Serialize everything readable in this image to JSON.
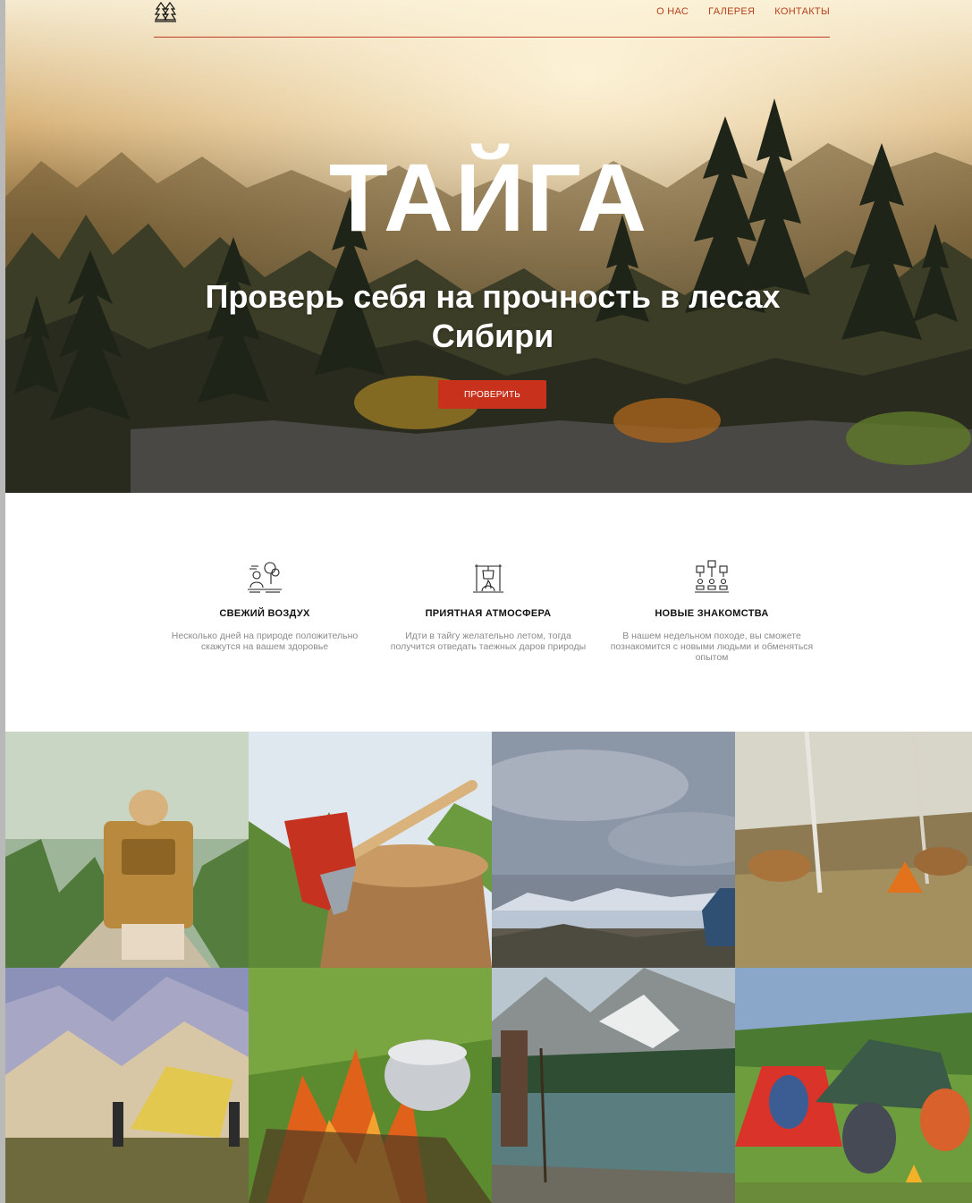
{
  "nav": {
    "logo_icon": "pine-trees-icon",
    "links": [
      "О НАС",
      "ГАЛЕРЕЯ",
      "КОНТАКТЫ"
    ]
  },
  "hero": {
    "title": "ТАЙГА",
    "subtitle": "Проверь себя на прочность в лесах Сибири",
    "button_label": "ПРОВЕРИТЬ"
  },
  "features": [
    {
      "icon": "person-under-tree-icon",
      "title": "СВЕЖИЙ ВОЗДУХ",
      "text": "Несколько дней на природе положительно скажутся на вашем здоровье"
    },
    {
      "icon": "campfire-cooking-icon",
      "title": "ПРИЯТНАЯ АТМОСФЕРА",
      "text": "Идти в тайгу желательно летом, тогда получится отведать таежных даров природы"
    },
    {
      "icon": "people-network-icon",
      "title": "НОВЫЕ ЗНАКОМСТВА",
      "text": "В нашем недельном походе, вы сможете познакомится с новыми людьми и обменяться опытом"
    }
  ],
  "gallery": [
    {
      "photo": "hiker-with-backpack"
    },
    {
      "photo": "axe-in-stump"
    },
    {
      "photo": "mountain-lake-view"
    },
    {
      "photo": "wild-horses-field"
    },
    {
      "photo": "tent-setup-mountains"
    },
    {
      "photo": "campfire-pot"
    },
    {
      "photo": "hiker-by-lake"
    },
    {
      "photo": "campers-with-tents"
    }
  ],
  "colors": {
    "accent": "#c8321c",
    "nav_link": "#b4421d",
    "feature_text": "#8a8a8a"
  }
}
